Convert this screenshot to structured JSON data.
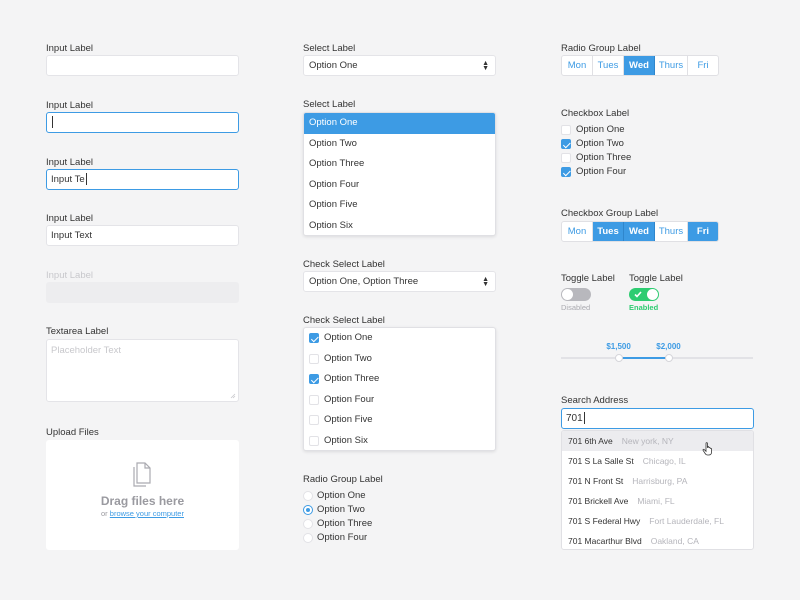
{
  "col1": {
    "input1": {
      "label": "Input Label",
      "value": ""
    },
    "input2": {
      "label": "Input Label",
      "value": ""
    },
    "input3": {
      "label": "Input Label",
      "value": "Input Te"
    },
    "input4": {
      "label": "Input Label",
      "value": "Input Text"
    },
    "input5": {
      "label": "Input Label",
      "value": ""
    },
    "textarea": {
      "label": "Textarea Label",
      "placeholder": "Placeholder Text"
    },
    "upload": {
      "label": "Upload Files",
      "title": "Drag files here",
      "or": "or",
      "link": "browse your computer"
    }
  },
  "col2": {
    "select1": {
      "label": "Select Label",
      "value": "Option One"
    },
    "select2": {
      "label": "Select Label",
      "options": [
        "Option One",
        "Option Two",
        "Option Three",
        "Option Four",
        "Option Five",
        "Option Six"
      ],
      "selected_index": 0
    },
    "check_select1": {
      "label": "Check Select Label",
      "value": "Option One, Option Three"
    },
    "check_select2": {
      "label": "Check Select Label",
      "options": [
        {
          "label": "Option One",
          "checked": true
        },
        {
          "label": "Option Two",
          "checked": false
        },
        {
          "label": "Option Three",
          "checked": true
        },
        {
          "label": "Option Four",
          "checked": false
        },
        {
          "label": "Option Five",
          "checked": false
        },
        {
          "label": "Option Six",
          "checked": false
        }
      ]
    },
    "radio_group": {
      "label": "Radio Group Label",
      "options": [
        {
          "label": "Option One",
          "selected": false
        },
        {
          "label": "Option Two",
          "selected": true
        },
        {
          "label": "Option Three",
          "selected": false
        },
        {
          "label": "Option Four",
          "selected": false
        }
      ]
    }
  },
  "col3": {
    "radio_seg": {
      "label": "Radio Group Label",
      "items": [
        {
          "label": "Mon",
          "on": false
        },
        {
          "label": "Tues",
          "on": false
        },
        {
          "label": "Wed",
          "on": true
        },
        {
          "label": "Thurs",
          "on": false
        },
        {
          "label": "Fri",
          "on": false
        }
      ]
    },
    "checkbox": {
      "label": "Checkbox Label",
      "options": [
        {
          "label": "Option One",
          "checked": false
        },
        {
          "label": "Option Two",
          "checked": true
        },
        {
          "label": "Option Three",
          "checked": false
        },
        {
          "label": "Option Four",
          "checked": true
        }
      ]
    },
    "check_seg": {
      "label": "Checkbox Group Label",
      "items": [
        {
          "label": "Mon",
          "on": false
        },
        {
          "label": "Tues",
          "on": true
        },
        {
          "label": "Wed",
          "on": true
        },
        {
          "label": "Thurs",
          "on": false
        },
        {
          "label": "Fri",
          "on": true
        }
      ]
    },
    "toggle_off": {
      "label": "Toggle Label",
      "state": "Disabled"
    },
    "toggle_on": {
      "label": "Toggle Label",
      "state": "Enabled"
    },
    "range": {
      "low_label": "$1,500",
      "high_label": "$2,000",
      "low_fraction": 0.3,
      "high_fraction": 0.56
    },
    "search": {
      "label": "Search Address",
      "value": "701",
      "results": [
        {
          "street": "701 6th Ave",
          "city": "New york, NY"
        },
        {
          "street": "701 S La Salle St",
          "city": "Chicago, IL"
        },
        {
          "street": "701 N Front St",
          "city": "Harrisburg, PA"
        },
        {
          "street": "701 Brickell Ave",
          "city": "Miami, FL"
        },
        {
          "street": "701 S Federal Hwy",
          "city": "Fort Lauderdale, FL"
        },
        {
          "street": "701 Macarthur Blvd",
          "city": "Oakland, CA"
        }
      ],
      "highlighted_index": 0
    },
    "colors": {
      "accent": "#3d9be4",
      "toggle_on": "#2ecc71",
      "toggle_off": "#b8b8bd"
    }
  }
}
